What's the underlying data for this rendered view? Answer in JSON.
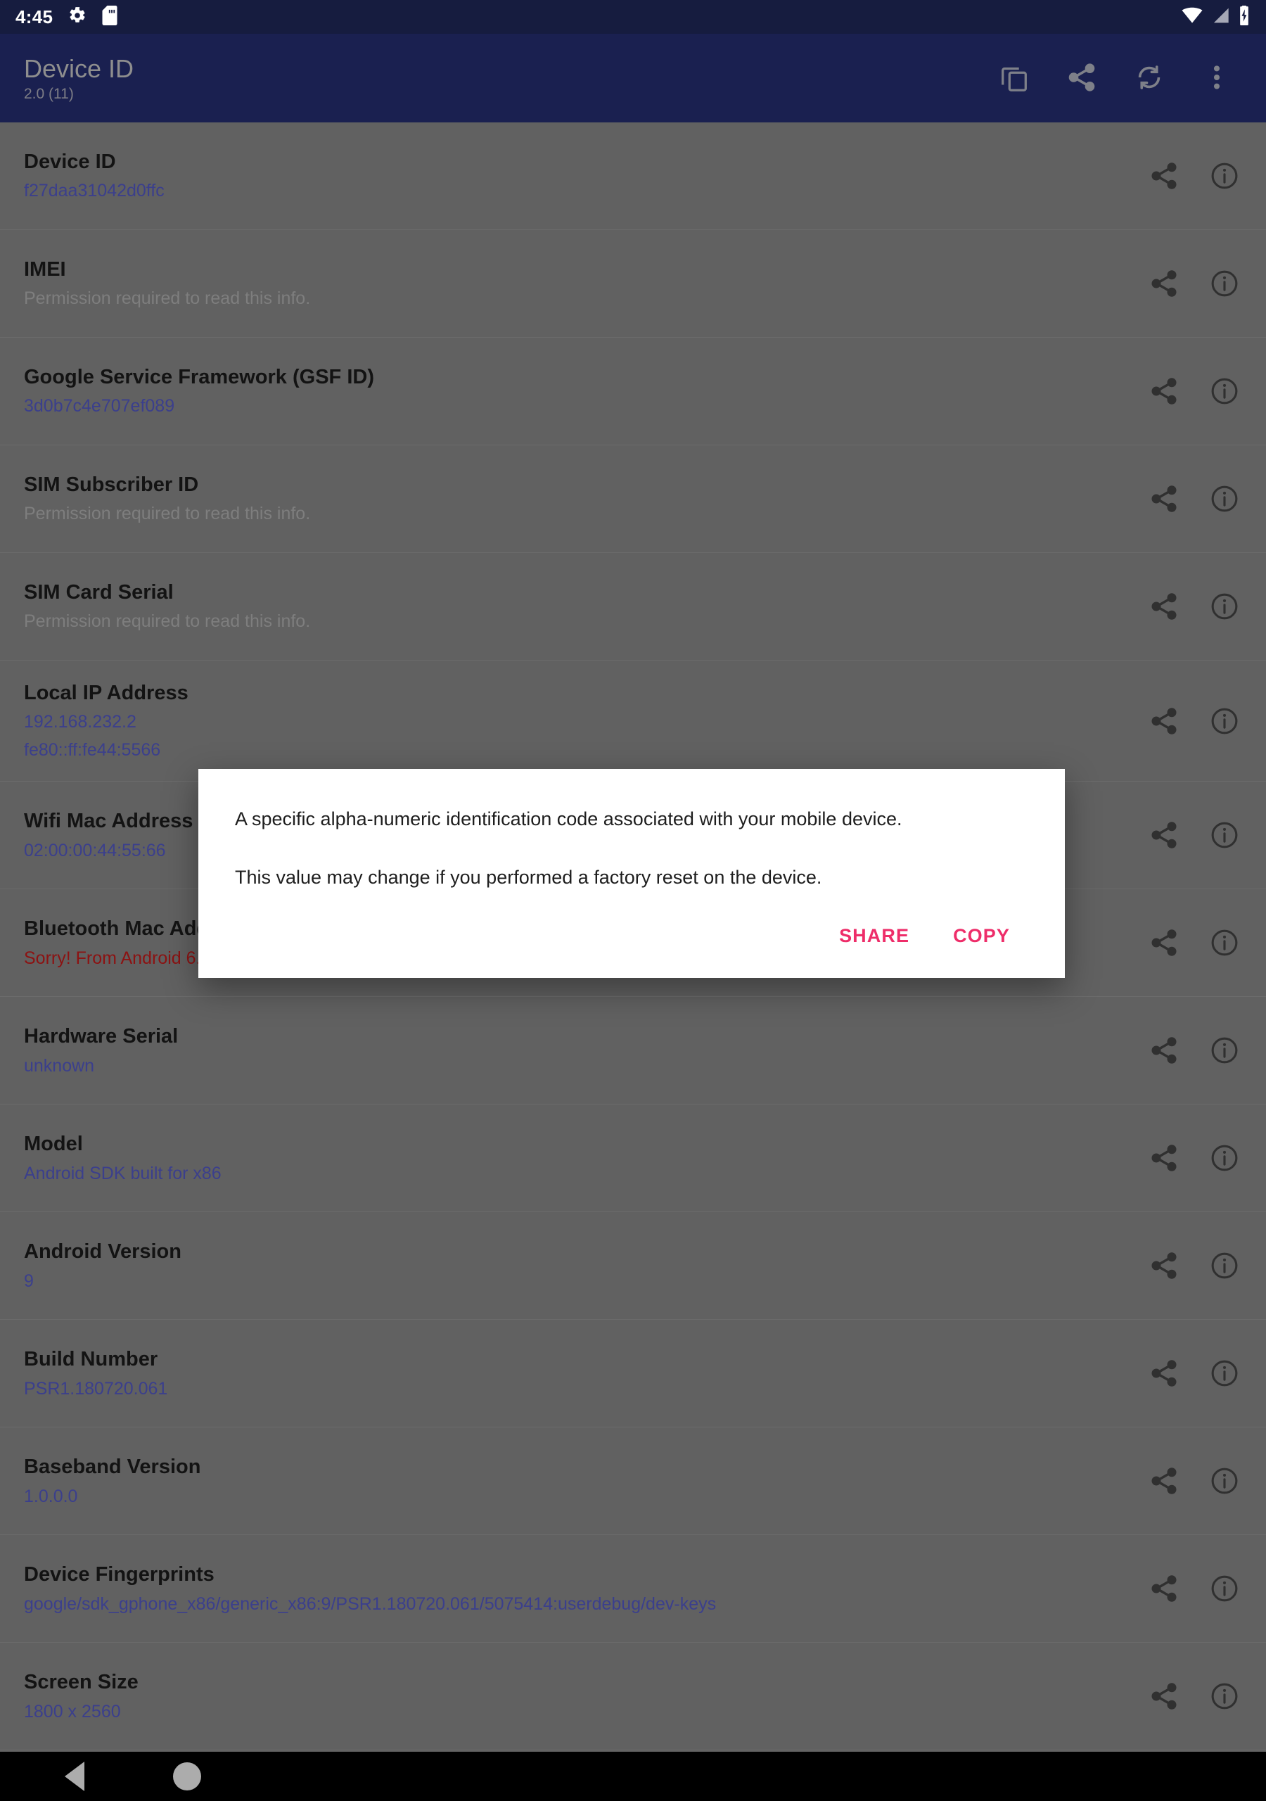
{
  "statusbar": {
    "clock": "4:45",
    "icons_left": [
      "gear-icon",
      "sd-card-icon"
    ],
    "icons_right": [
      "wifi-icon",
      "signal-icon",
      "battery-charging-icon"
    ]
  },
  "appbar": {
    "title": "Device ID",
    "subtitle": "2.0 (11)",
    "actions": [
      {
        "name": "copy-all-button",
        "icon": "copy-icon"
      },
      {
        "name": "share-all-button",
        "icon": "share-icon"
      },
      {
        "name": "refresh-button",
        "icon": "refresh-icon"
      },
      {
        "name": "overflow-menu-button",
        "icon": "more-vertical-icon"
      }
    ]
  },
  "list": {
    "row_action_icons": [
      "share-icon",
      "info-icon"
    ],
    "items": [
      {
        "label": "Device ID",
        "value": "f27daa31042d0ffc",
        "style": "value"
      },
      {
        "label": "IMEI",
        "value": "Permission required to read this info.",
        "style": "muted"
      },
      {
        "label": "Google Service Framework (GSF ID)",
        "value": "3d0b7c4e707ef089",
        "style": "value"
      },
      {
        "label": "SIM Subscriber ID",
        "value": "Permission required to read this info.",
        "style": "muted"
      },
      {
        "label": "SIM Card Serial",
        "value": "Permission required to read this info.",
        "style": "muted"
      },
      {
        "label": "Local IP Address",
        "value": "192.168.232.2",
        "value2": "fe80::ff:fe44:5566",
        "style": "value"
      },
      {
        "label": "Wifi Mac Address",
        "value": "02:00:00:44:55:66",
        "style": "value"
      },
      {
        "label": "Bluetooth Mac Address",
        "value": "Sorry! From Android 6.0 this is not visible on the screen.",
        "style": "warn"
      },
      {
        "label": "Hardware Serial",
        "value": "unknown",
        "style": "value"
      },
      {
        "label": "Model",
        "value": "Android SDK built for x86",
        "style": "value"
      },
      {
        "label": "Android Version",
        "value": "9",
        "style": "value"
      },
      {
        "label": "Build Number",
        "value": "PSR1.180720.061",
        "style": "value"
      },
      {
        "label": "Baseband Version",
        "value": "1.0.0.0",
        "style": "value"
      },
      {
        "label": "Device Fingerprints",
        "value": "google/sdk_gphone_x86/generic_x86:9/PSR1.180720.061/5075414:userdebug/dev-keys",
        "style": "value"
      },
      {
        "label": "Screen Size",
        "value": "1800 x 2560",
        "style": "value"
      }
    ]
  },
  "dialog": {
    "paragraph1": "A specific alpha-numeric identification code associated with your mobile device.",
    "paragraph2": "This value may change if you performed a factory reset on the device.",
    "share_label": "SHARE",
    "copy_label": "COPY"
  },
  "navbar": {
    "back": "back-triangle-icon",
    "home": "home-circle-icon"
  },
  "colors": {
    "statusbar_bg": "#161C3F",
    "appbar_bg": "#1A2050",
    "scrim_bg": "#616161",
    "accent_pink": "#EE2D69",
    "value_blue": "#3B3F8C",
    "warn_red": "#8C1212"
  }
}
